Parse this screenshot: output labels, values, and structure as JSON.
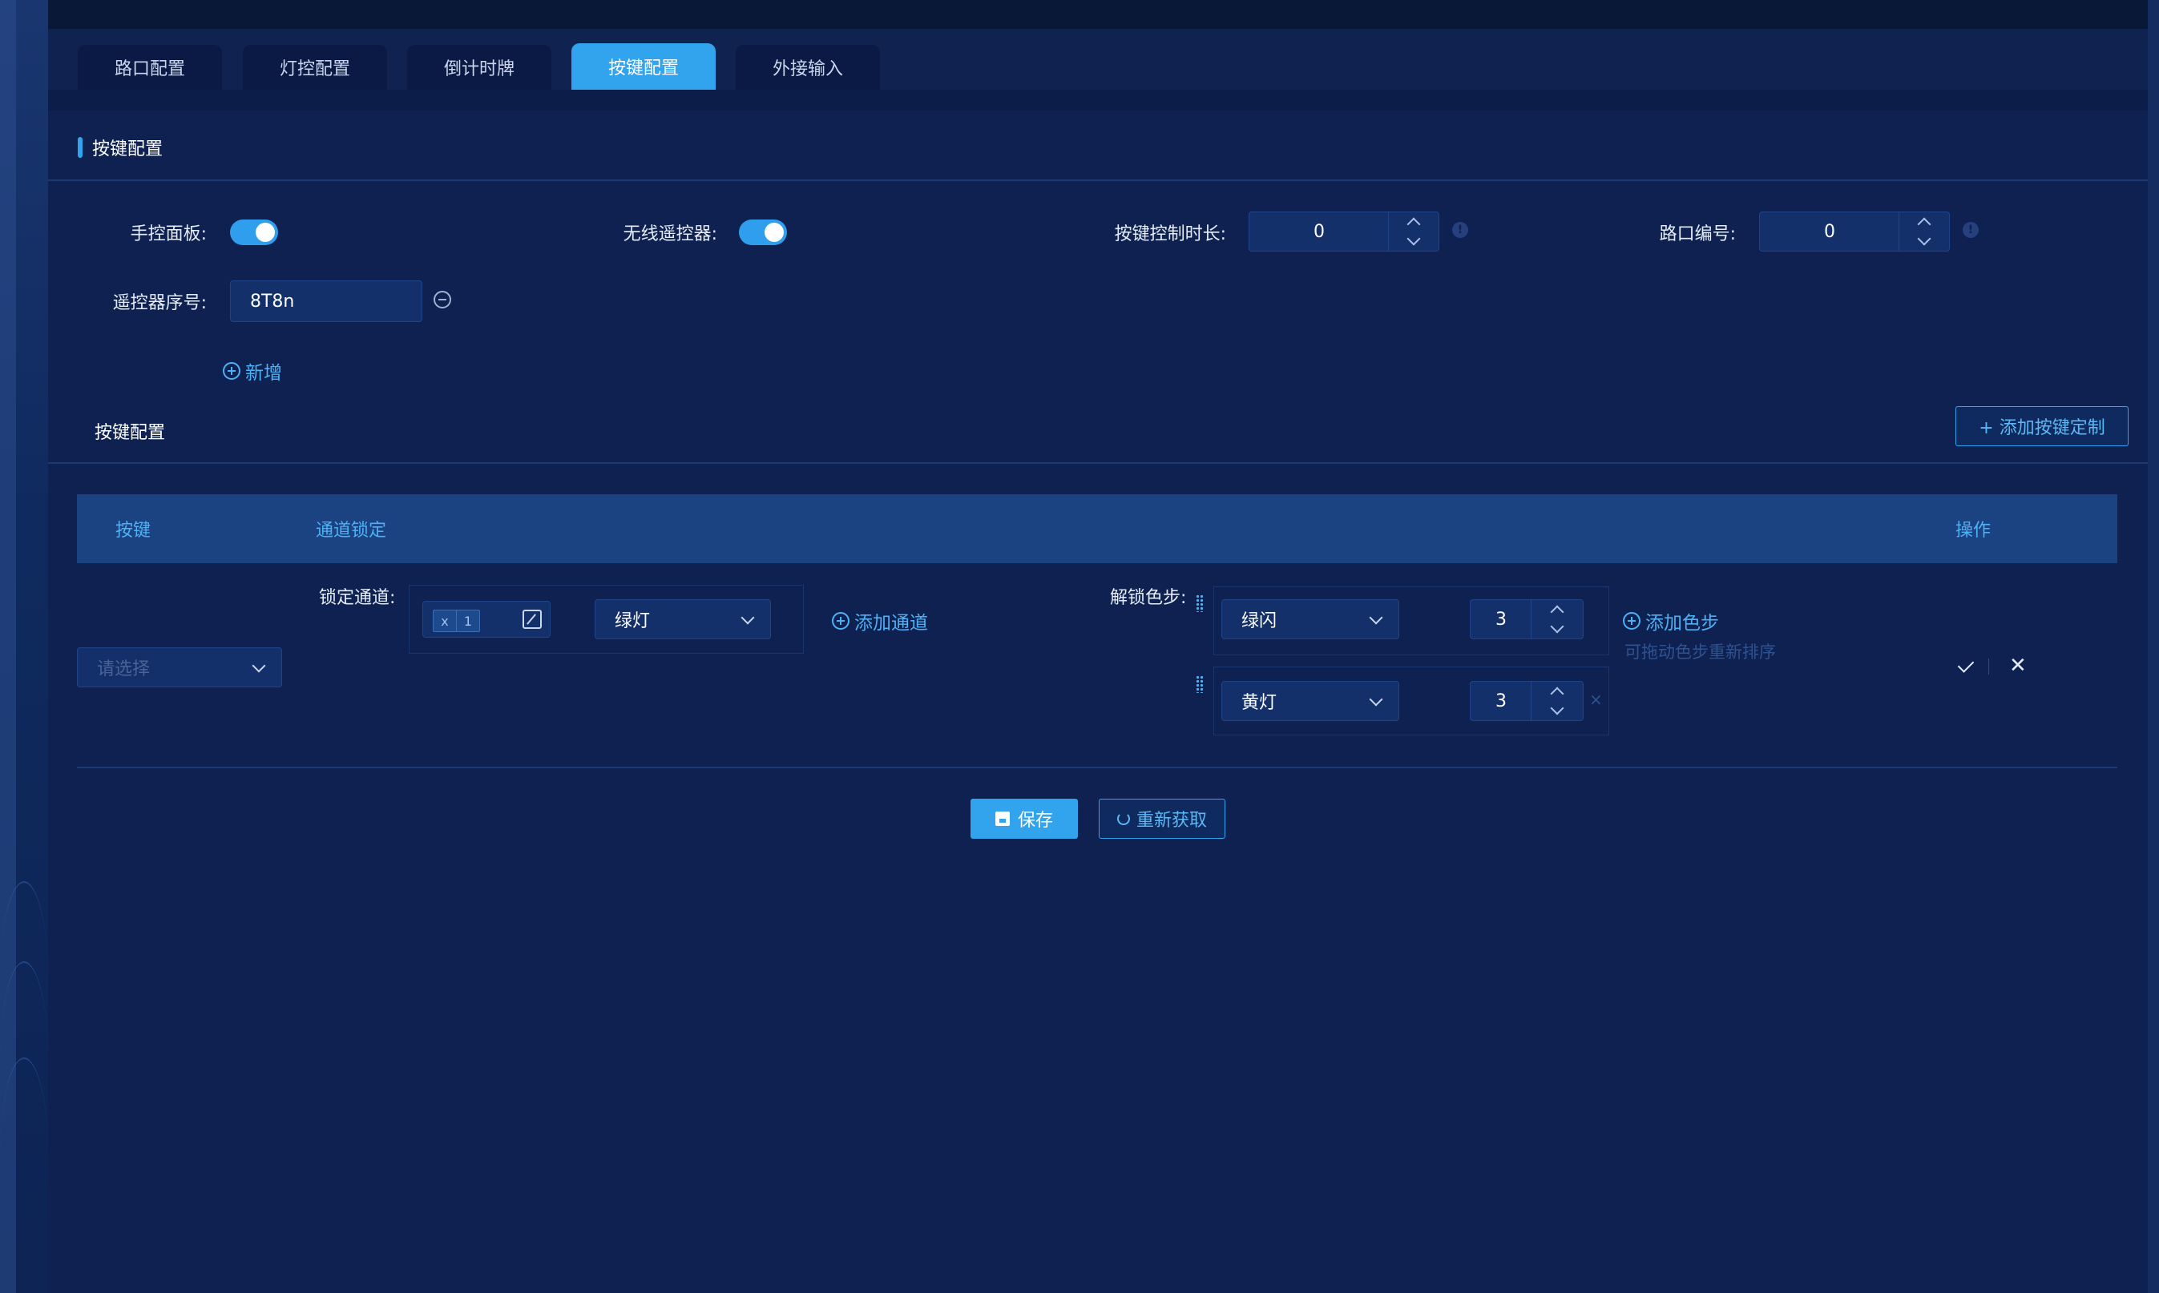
{
  "tabs": [
    "路口配置",
    "灯控配置",
    "倒计时牌",
    "按键配置",
    "外接输入"
  ],
  "active_tab": "按键配置",
  "section_title": "按键配置",
  "form": {
    "manual_panel_label": "手控面板:",
    "manual_panel_on": true,
    "wireless_remote_label": "无线遥控器:",
    "wireless_remote_on": true,
    "duration_label": "按键控制时长:",
    "duration_value": "0",
    "crossing_id_label": "路口编号:",
    "crossing_id_value": "0",
    "remote_serial_label": "遥控器序号:",
    "remote_serial_value": "8T8n",
    "add_new": "新增"
  },
  "key_config": {
    "title": "按键配置",
    "add_button": "+ 添加按键定制",
    "columns": {
      "key": "按键",
      "channel_lock": "通道锁定",
      "actions": "操作"
    },
    "row": {
      "key_placeholder": "请选择",
      "lock_channel_label": "锁定通道:",
      "channel_tag_x": "x",
      "channel_tag_num": "1",
      "channel_color": "绿灯",
      "add_channel": "添加通道",
      "unlock_label": "解锁色步:",
      "steps": [
        {
          "color": "绿闪",
          "value": "3"
        },
        {
          "color": "黄灯",
          "value": "3"
        }
      ],
      "add_step": "添加色步",
      "drag_hint": "可拖动色步重新排序",
      "step_remove": "×"
    }
  },
  "footer": {
    "save": "保存",
    "refetch": "重新获取"
  },
  "colors": {
    "accent": "#32a4ee",
    "background": "#0e2150"
  },
  "icons": [
    "save-icon",
    "refresh-icon",
    "check-icon",
    "close-icon",
    "drag-handle-icon",
    "info-icon",
    "minus-circle-icon",
    "plus-circle-icon",
    "edit-icon",
    "chevron-down-icon"
  ]
}
